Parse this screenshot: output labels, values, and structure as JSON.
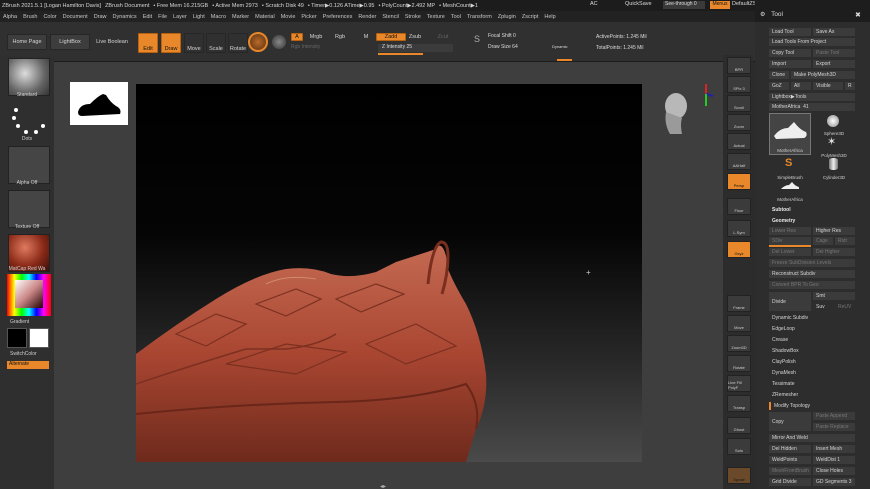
{
  "titlebar": {
    "app": "ZBrush 2021.5.1 [Logan Hamilton Davis]",
    "doc": "ZBrush Document",
    "free_mem": "• Free Mem 16.215GB",
    "active_mem": "• Active Mem 2973",
    "scratch": "• Scratch Disk 49",
    "timer": "• Timer▶0.126 ATime▶0.95",
    "polycount": "• PolyCount▶2.492 MP",
    "meshcount": "• MeshCount▶1",
    "ac": "AC",
    "quicksave": "QuickSave",
    "seethrough": "See-through",
    "seethrough_val": "0",
    "menus": "Menus",
    "defaultzscript": "DefaultZScript"
  },
  "menubar": [
    "Alpha",
    "Brush",
    "Color",
    "Document",
    "Draw",
    "Dynamics",
    "Edit",
    "File",
    "Layer",
    "Light",
    "Macro",
    "Marker",
    "Material",
    "Movie",
    "Picker",
    "Preferences",
    "Render",
    "Stencil",
    "Stroke",
    "Texture",
    "Tool",
    "Transform",
    "Zplugin",
    "Zscript",
    "Help"
  ],
  "toolbar": {
    "home_page": "Home Page",
    "lightbox": "LightBox",
    "live_boolean": "Live Boolean",
    "edit": "Edit",
    "draw": "Draw",
    "move": "Move",
    "scale": "Scale",
    "rotate": "Rotate",
    "a": "A",
    "mrgb": "Mrgb",
    "rgb": "Rgb",
    "m": "M",
    "zadd": "Zadd",
    "zsub": "Zsub",
    "zcut": "Zcut",
    "rgb_intensity": "Rgb Intensity",
    "z_intensity": "Z Intensity 25",
    "focal_shift": "Focal Shift 0",
    "draw_size": "Draw Size 64",
    "dynamic": "Dynamic",
    "active_points": "ActivePoints: 1.245 Mil",
    "total_points": "TotalPoints: 1.245 Mil"
  },
  "leftpanel": {
    "standard": "Standard",
    "dots": "Dots",
    "alpha_off": "Alpha Off",
    "texture_off": "Texture Off",
    "matcap": "MatCap Red Wa",
    "gradient": "Gradient",
    "switchcolor": "SwitchColor",
    "alternate": "Alternate"
  },
  "rshelf": [
    "BPR",
    "SPix 3",
    "Scroll",
    "Zoom",
    "Actual",
    "AAHalf",
    "Persp",
    "Floor",
    "L.Sym",
    "Gxyz",
    "Frame",
    "Move",
    "Zoom3D",
    "Rotate",
    "Line Fill PolyF",
    "Transp",
    "Ghost",
    "Solo",
    "Xpose"
  ],
  "toolpanel": {
    "title": "Tool",
    "load_tool": "Load Tool",
    "save_as": "Save As",
    "load_tools_project": "Load Tools From Project",
    "copy_tool": "Copy Tool",
    "paste_tool": "Paste Tool",
    "import": "Import",
    "export": "Export",
    "clone": "Clone",
    "make_polymesh": "Make PolyMesh3D",
    "goz": "GoZ",
    "all": "All",
    "visible": "Visible",
    "r": "R",
    "lightbox_tools": "Lightbox▶Tools",
    "mother_africa": "MotherAfrica",
    "mother_africa_val": "41",
    "tools": [
      "MotherAfrica",
      "Sphere3D",
      "PolyMesh3D",
      "SimpleBrush",
      "Cylinder3D",
      "MotherAfrica"
    ],
    "subtool": "Subtool",
    "geometry": "Geometry",
    "lower_res": "Lower Res",
    "higher_res": "Higher Res",
    "sdiv": "SDiv",
    "cage": "Cage",
    "rstr": "Rstr",
    "del_lower": "Del Lower",
    "del_higher": "Del Higher",
    "freeze_subdiv": "Freeze SubDivision Levels",
    "reconstruct_subdiv": "Reconstruct Subdiv",
    "convert_bpr": "Convert BPR To Geo",
    "divide": "Divide",
    "smt": "Smt",
    "suv": "Suv",
    "reuv": "ReUV",
    "dynamic_subdiv": "Dynamic Subdiv",
    "edgeloop": "EdgeLoop",
    "crease": "Crease",
    "shadowbox": "ShadowBox",
    "claypolish": "ClayPolish",
    "dynamesh": "DynaMesh",
    "tessimate": "Tessimate",
    "zremesher": "ZRemesher",
    "modify_topology": "Modify Topology",
    "copy": "Copy",
    "paste_append": "Paste Append",
    "paste_replace": "Paste Replace",
    "mirror_weld": "Mirror And Weld",
    "del_hidden": "Del Hidden",
    "insert_mesh": "Insert Mesh",
    "weldpoints": "WeldPoints",
    "welddist": "WeldDist 1",
    "meshfrombrush": "MeshFromBrush",
    "close_holes": "Close Holes",
    "grid_divide": "Grid Divide",
    "gd_segments": "GD Segments 3"
  },
  "colors": {
    "accent": "#e8882a",
    "clay": "#b5503a"
  }
}
